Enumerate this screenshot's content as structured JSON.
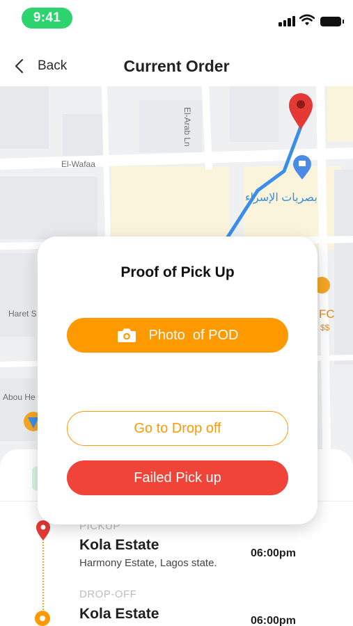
{
  "status_bar": {
    "time": "9:41"
  },
  "header": {
    "back_label": "Back",
    "title": "Current Order"
  },
  "map": {
    "labels": {
      "street_vertical": "El-Arab Ln",
      "street_wafaa": "El-Wafaa",
      "haret": "Haret S",
      "abou": "Abou He",
      "arabic_place": "بصريات الإسراء",
      "kfc": "FC",
      "price": "$$"
    },
    "route_color": "#3b8ee8",
    "pin_color": "#e53935"
  },
  "modal": {
    "title": "Proof of Pick Up",
    "photo_button": "Photo  of POD",
    "drop_button": "Go to Drop off",
    "fail_button": "Failed Pick up"
  },
  "stops": [
    {
      "tag": "PICKUP",
      "name": "Kola Estate",
      "address": "Harmony Estate, Lagos state.",
      "time": "06:00pm"
    },
    {
      "tag": "DROP-OFF",
      "name": "Kola Estate",
      "time": "06:00pm"
    }
  ],
  "colors": {
    "accent": "#ff9900",
    "danger": "#f04438",
    "status_green": "#2dd36f"
  }
}
